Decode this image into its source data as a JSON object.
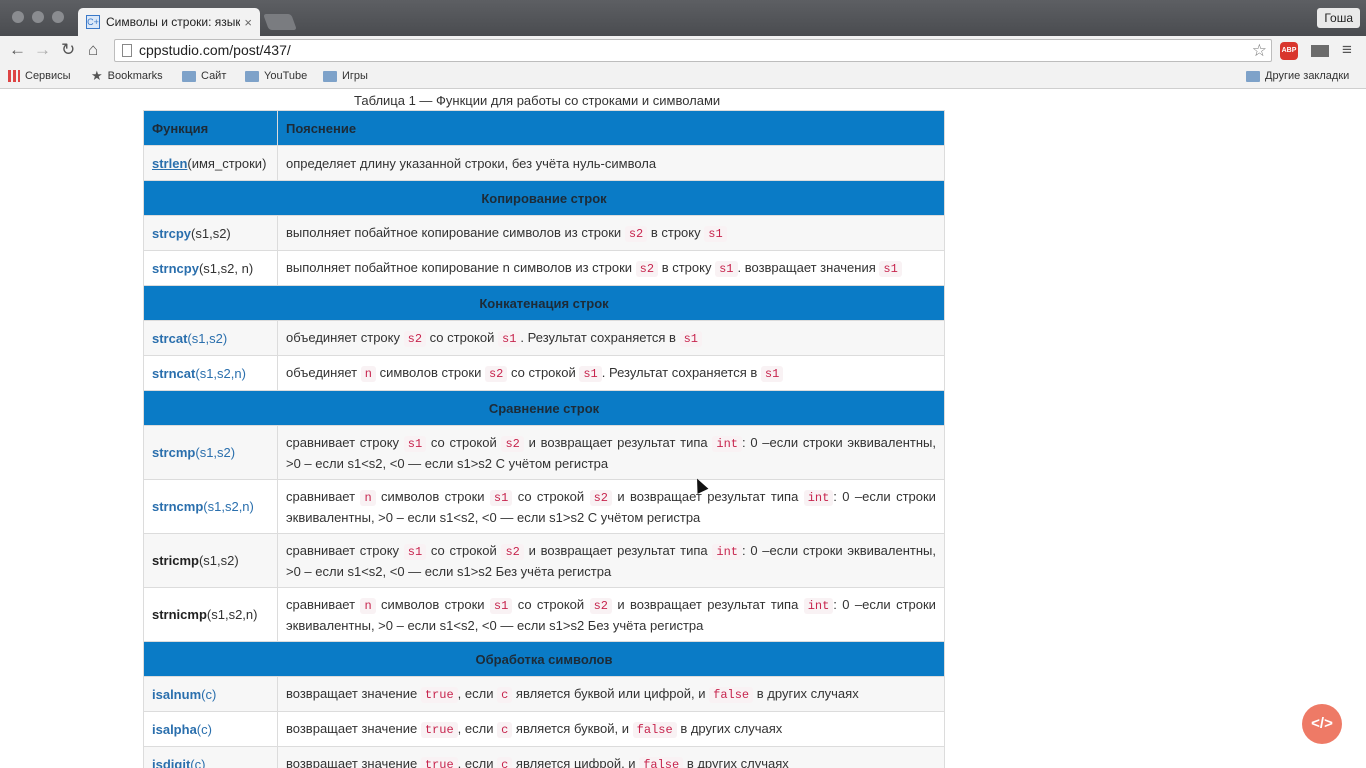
{
  "browser": {
    "tab_title": "Символы и строки: язык п",
    "tab_close": "×",
    "favicon_text": "C+",
    "user_button": "Гоша",
    "url": "cppstudio.com/post/437/",
    "back": "←",
    "forward": "→",
    "reload": "↻",
    "home": "⌂",
    "star": "☆",
    "abp": "ABP",
    "menu": "≡"
  },
  "bookmarks": {
    "apps": "Сервисы",
    "bookmarks": "Bookmarks",
    "site": "Сайт",
    "youtube": "YouTube",
    "games": "Игры",
    "other": "Другие закладки"
  },
  "page": {
    "caption": "Таблица 1 — Функции для работы со строками и символами",
    "header_function": "Функция",
    "header_desc": "Пояснение",
    "sections": {
      "copy": "Копирование строк",
      "concat": "Конкатенация строк",
      "compare": "Сравнение строк",
      "chars": "Обработка символов"
    },
    "rows": {
      "strlen": {
        "name": "strlen",
        "args": "(имя_строки)",
        "desc": "определяет длину указанной строки, без учёта нуль-символа"
      },
      "strcpy": {
        "name": "strcpy",
        "args": "(s1,s2)",
        "d1": "выполняет побайтное копирование символов из строки",
        "c1": "s2",
        "d2": "в строку",
        "c2": "s1"
      },
      "strncpy": {
        "name": "strncpy",
        "args": "(s1,s2, n)",
        "d1": "выполняет побайтное копирование n символов из строки",
        "c1": "s2",
        "d2": "в строку",
        "c2": "s1",
        "d3": ". возвращает значения",
        "c3": "s1"
      },
      "strcat": {
        "name": "strcat",
        "args": "(s1,s2)",
        "d1": "объединяет строку",
        "c1": "s2",
        "d2": "со строкой",
        "c2": "s1",
        "d3": ". Результат сохраняется в",
        "c3": "s1"
      },
      "strncat": {
        "name": "strncat",
        "args": "(s1,s2,n)",
        "d1": "объединяет",
        "c1": "n",
        "d2": "символов строки",
        "c2": "s2",
        "d3": "со строкой",
        "c3": "s1",
        "d4": ". Результат сохраняется в",
        "c4": "s1"
      },
      "strcmp": {
        "name": "strcmp",
        "args": "(s1,s2)",
        "d1": "сравнивает строку",
        "c1": "s1",
        "d2": "со строкой",
        "c2": "s2",
        "d3": "и возвращает результат типа",
        "c3": "int",
        "d4": ": 0 –если строки эквивалентны, >0 – если s1<s2,  <0  — если s1>s2 С учётом регистра"
      },
      "strncmp": {
        "name": "strncmp",
        "args": "(s1,s2,n)",
        "d1": "сравнивает",
        "c1": "n",
        "d2": "символов строки",
        "c2": "s1",
        "d3": "со строкой",
        "c3": "s2",
        "d4": "и возвращает результат типа",
        "c4": "int",
        "d5": ": 0 –если строки эквивалентны, >0 – если s1<s2,  <0  — если s1>s2 С учётом регистра"
      },
      "stricmp": {
        "name": "stricmp",
        "args": "(s1,s2)",
        "d1": "сравнивает строку",
        "c1": "s1",
        "d2": "со строкой",
        "c2": "s2",
        "d3": "и возвращает результат типа",
        "c3": "int",
        "d4": ": 0 –если строки эквивалентны, >0 – если s1<s2,  <0  — если s1>s2 Без учёта регистра"
      },
      "strnicmp": {
        "name": "strnicmp",
        "args": "(s1,s2,n)",
        "d1": "сравнивает",
        "c1": "n",
        "d2": "символов строки",
        "c2": "s1",
        "d3": "со строкой",
        "c3": "s2",
        "d4": "и возвращает результат типа",
        "c4": "int",
        "d5": ": 0 –если строки эквивалентны, >0 – если s1<s2,  <0 — если s1>s2 Без учёта регистра"
      },
      "isalnum": {
        "name": "isalnum",
        "args": "(c)",
        "d1": "возвращает значение",
        "c1": "true",
        "d2": ", если",
        "c2": "c",
        "d3": "является буквой или цифрой, и",
        "c3": "false",
        "d4": "в других случаях"
      },
      "isalpha": {
        "name": "isalpha",
        "args": "(c)",
        "d1": "возвращает значение",
        "c1": "true",
        "d2": ", если",
        "c2": "c",
        "d3": "является буквой,  и",
        "c3": "false",
        "d4": "в других случаях"
      },
      "isdigit": {
        "name": "isdigit",
        "args": "(c)",
        "d1": "возвращает значение",
        "c1": "true",
        "d2": ", если",
        "c2": "c",
        "d3": "является цифрой, и",
        "c3": "false",
        "d4": "в других случаях"
      }
    },
    "fab_label": "</>"
  }
}
